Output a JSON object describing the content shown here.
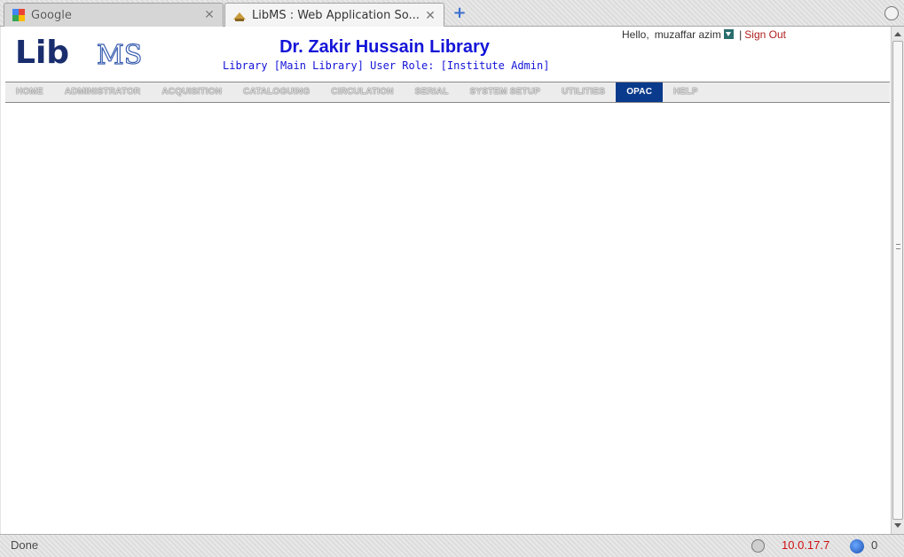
{
  "browser": {
    "tabs": [
      {
        "title": "Google",
        "icon": "google-favicon",
        "close_icon": "close-icon"
      },
      {
        "title": "LibMS : Web Application So...",
        "icon": "libms-favicon",
        "close_icon": "close-icon"
      }
    ],
    "new_tab_glyph": "+",
    "status": {
      "text": "Done",
      "ip": "10.0.17.7",
      "count": "0"
    }
  },
  "header": {
    "logo_text": {
      "lib": "Lib",
      "ms": "MS"
    },
    "title": "Dr. Zakir Hussain Library",
    "subtitle": "Library [Main Library]  User Role: [Institute Admin]",
    "greeting": "Hello,",
    "user_name": "muzaffar azim",
    "separator": "|",
    "sign_out": "Sign Out"
  },
  "nav": {
    "items": [
      {
        "label": "HOME"
      },
      {
        "label": "ADMINISTRATOR"
      },
      {
        "label": "ACQUISITION"
      },
      {
        "label": "CATALOGUING"
      },
      {
        "label": "CIRCULATION"
      },
      {
        "label": "SERIAL"
      },
      {
        "label": "SYSTEM SETUP"
      },
      {
        "label": "UTILITIES"
      },
      {
        "label": "OPAC",
        "active": true
      },
      {
        "label": "HELP"
      }
    ]
  },
  "colors": {
    "title": "#1414d8",
    "nav_active": "#0a3a8c",
    "sign_out": "#b01e1e",
    "status_ip": "#d01010"
  }
}
